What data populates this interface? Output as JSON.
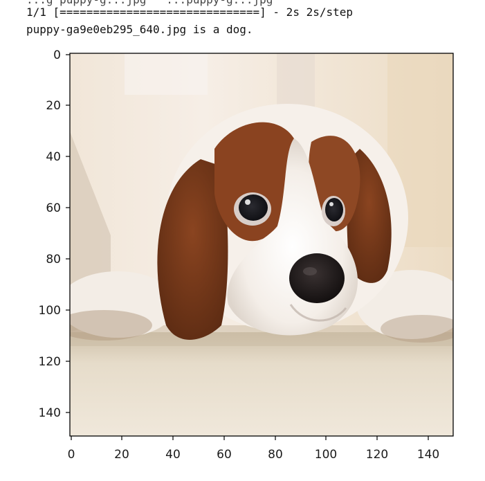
{
  "console": {
    "clipped_line": "...g puppy-g...jpg   ...puppy-g...jpg",
    "progress_line": "1/1 [==============================] - 2s 2s/step",
    "result_line": "puppy-ga9e0eb295_640.jpg is a dog."
  },
  "figure": {
    "image_subject": "cavalier-king-charles-spaniel-puppy-photo",
    "x_ticks": [
      "0",
      "20",
      "40",
      "60",
      "80",
      "100",
      "120",
      "140"
    ],
    "y_ticks": [
      "0",
      "20",
      "40",
      "60",
      "80",
      "100",
      "120",
      "140"
    ],
    "x_range": [
      -0.5,
      149.5
    ],
    "y_range": [
      149.5,
      -0.5
    ],
    "colors": {
      "wall": "#efe3d2",
      "carpet": "#e2d6c2",
      "fur_white": "#f7f1ea",
      "fur_brown": "#7a3a1a",
      "nose": "#221a19"
    }
  }
}
